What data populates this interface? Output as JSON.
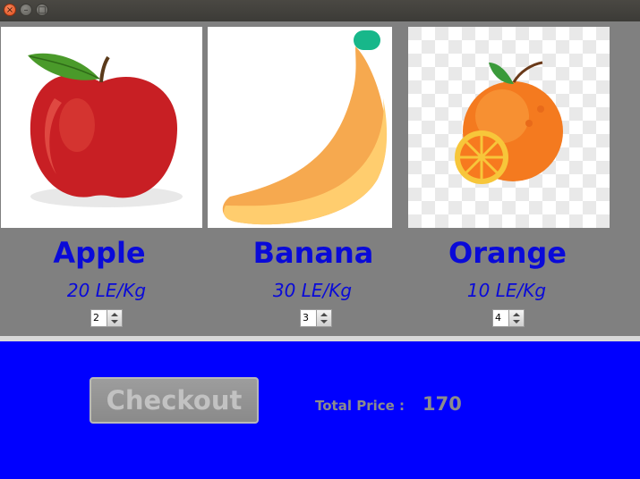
{
  "window": {
    "buttons": [
      "close",
      "minimize",
      "maximize"
    ]
  },
  "products": [
    {
      "name": "Apple",
      "price": "20 LE/Kg",
      "quantity": "2",
      "icon": "apple-icon"
    },
    {
      "name": "Banana",
      "price": "30 LE/Kg",
      "quantity": "3",
      "icon": "banana-icon"
    },
    {
      "name": "Orange",
      "price": "10 LE/Kg",
      "quantity": "4",
      "icon": "orange-icon"
    }
  ],
  "footer": {
    "checkout_label": "Checkout",
    "total_label": "Total Price :",
    "total_value": "170"
  },
  "colors": {
    "accent": "#0a0ad8",
    "footer_bg": "#0000ff",
    "panel_bg": "#808080"
  }
}
